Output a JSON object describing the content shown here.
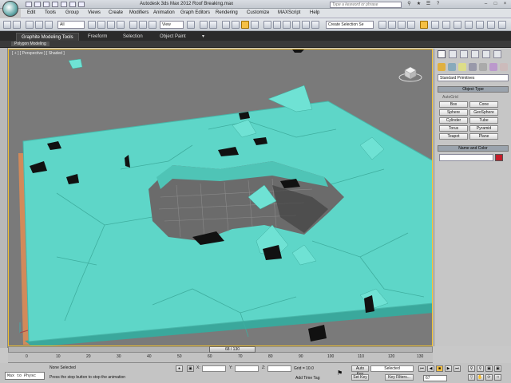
{
  "window": {
    "title": "Autodesk 3ds Max 2012      Roof Breaking.max",
    "search_placeholder": "Type a keyword or phrase"
  },
  "menu": [
    "Edit",
    "Tools",
    "Group",
    "Views",
    "Create",
    "Modifiers",
    "Animation",
    "Graph Editors",
    "Rendering",
    "Customize",
    "MAXScript",
    "Help"
  ],
  "toolbar": {
    "selection_filter": "All",
    "ref_coord": "View",
    "named_selection": "Create Selection Se"
  },
  "ribbon": {
    "tabs": [
      "Graphite Modeling Tools",
      "Freeform",
      "Selection",
      "Object Paint"
    ],
    "sub_label": "Polygon Modeling"
  },
  "viewport": {
    "label": "[ + ] [ Perspective ] [ Shaded ]",
    "colors": {
      "floor": "#5ed6c8",
      "background": "#7a7a7a",
      "hole": "#6b6b6b"
    }
  },
  "command_panel": {
    "category": "Standard Primitives",
    "rollout_object_type": "Object Type",
    "autogrid": "AutoGrid",
    "object_buttons": [
      "Box",
      "Cone",
      "Sphere",
      "GeoSphere",
      "Cylinder",
      "Tube",
      "Torus",
      "Pyramid",
      "Teapot",
      "Plane"
    ],
    "rollout_name_color": "Name and Color",
    "swatch_color": "#c41d2a"
  },
  "timeline": {
    "slider_label": "68 / 130",
    "ticks": [
      "0",
      "10",
      "20",
      "30",
      "40",
      "50",
      "60",
      "70",
      "80",
      "90",
      "100",
      "110",
      "120",
      "130"
    ]
  },
  "status": {
    "maxscript": "Max to Physc",
    "selection": "None Selected",
    "prompt": "Press the stop button to stop the animation",
    "coord_x": "X:",
    "coord_y": "Y:",
    "coord_z": "Z:",
    "grid": "Grid = 10.0",
    "add_time_tag": "Add Time Tag",
    "auto_key": "Auto Key",
    "set_key": "Set Key",
    "key_mode": "Selected",
    "key_filters": "Key Filters...",
    "frame": "67"
  }
}
